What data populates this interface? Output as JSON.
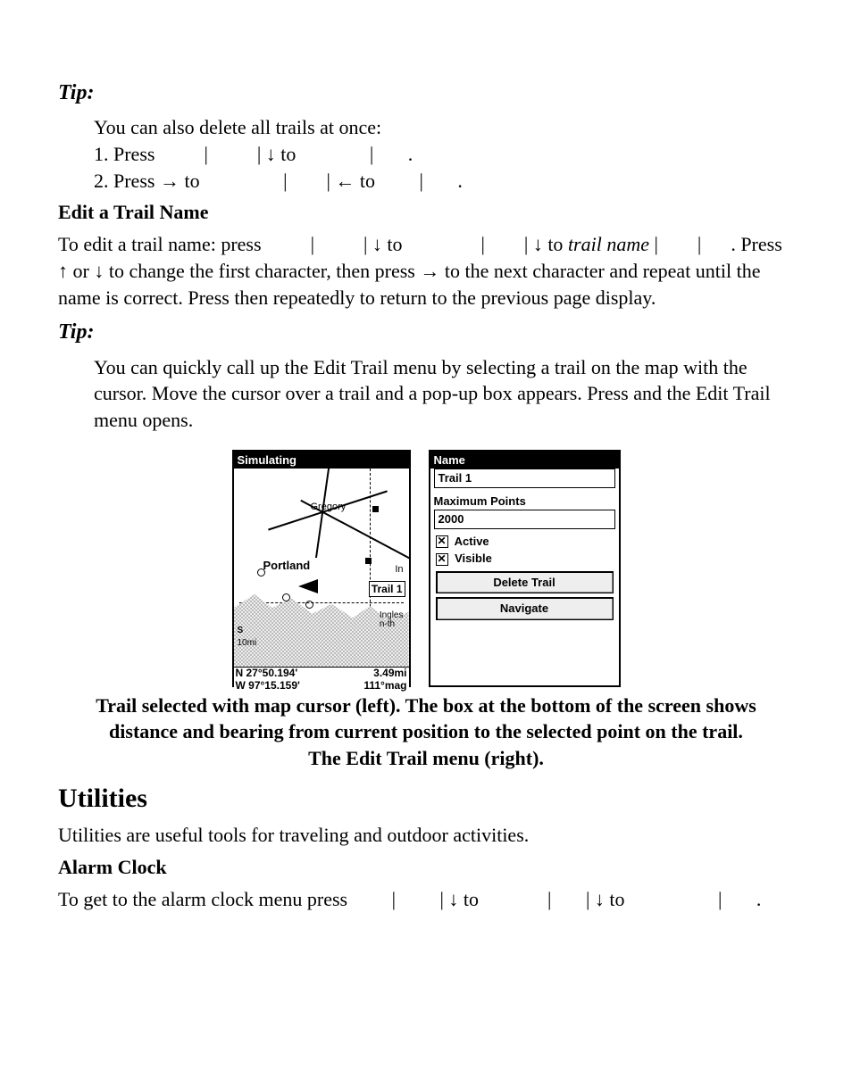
{
  "tip1": {
    "heading": "Tip:",
    "line0": "You can also delete all trails at once:",
    "step1_a": "1. Press",
    "step1_b": " to",
    "step2_a": "2. Press ",
    "step2_b": " to",
    "step2_c": " to"
  },
  "edit": {
    "heading": "Edit a Trail Name",
    "p1_a": "To edit a trail name: press",
    "p1_b": " to",
    "p1_c": " to ",
    "p1_trail": "trail name",
    "p1_d": ". Press ",
    "p1_e": " or ",
    "p1_f": " to change the first character, then press ",
    "p1_g": " to the next character and repeat until the name is correct. Press         then         repeatedly to return to the previous page display."
  },
  "tip2": {
    "heading": "Tip:",
    "text": "You can quickly call up the Edit Trail menu by selecting a trail on the map with the cursor. Move the cursor over a trail and a pop-up box appears. Press         and the Edit Trail menu opens."
  },
  "left_screen": {
    "header": "Simulating",
    "gregory": "Gregory",
    "portland": "Portland",
    "in": "In",
    "ingles1": "Ingles",
    "ingles2": "n-th",
    "trail_label": "Trail 1",
    "scale_s": "S",
    "scale_dist": "10mi",
    "coord_n": "N  27°50.194'",
    "coord_w": "W  97°15.159'",
    "dist": "3.49mi",
    "bearing": "111°mag"
  },
  "right_screen": {
    "name_label": "Name",
    "name_value": "Trail 1",
    "max_label": "Maximum Points",
    "max_value": "2000",
    "active": "Active",
    "visible": "Visible",
    "delete": "Delete  Trail",
    "navigate": "Navigate"
  },
  "caption": "Trail selected with map cursor (left). The box at the bottom of the screen shows distance and bearing from current position to the selected point on the trail. The Edit Trail menu (right).",
  "utilities": {
    "heading": "Utilities",
    "intro": "Utilities are useful tools for traveling and outdoor activities.",
    "alarm_heading": "Alarm Clock",
    "alarm_a": "To get to the alarm clock menu press",
    "alarm_b": " to",
    "alarm_c": " to"
  },
  "glyphs": {
    "bar": "|",
    "down": "↓",
    "up": "↑",
    "right": "→",
    "left": "←",
    "period": "."
  }
}
